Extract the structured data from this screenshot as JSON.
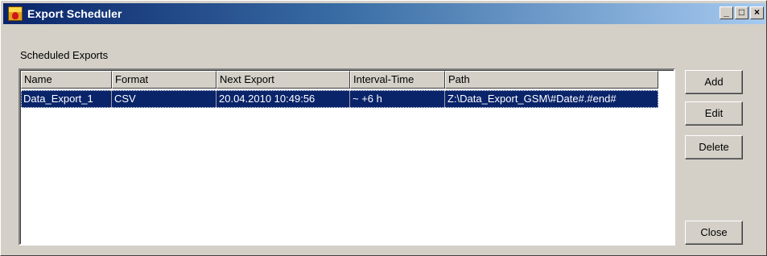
{
  "window": {
    "title": "Export Scheduler",
    "controls": {
      "minimize": "_",
      "maximize": "□",
      "close": "×"
    }
  },
  "group": {
    "label": "Scheduled Exports"
  },
  "table": {
    "columns": [
      "Name",
      "Format",
      "Next Export",
      "Interval-Time",
      "Path"
    ],
    "rows": [
      [
        "Data_Export_1",
        "CSV",
        "20.04.2010 10:49:56",
        "~ +6 h",
        "Z:\\Data_Export_GSM\\#Date#.#end#"
      ]
    ]
  },
  "buttons": {
    "add": "Add",
    "edit": "Edit",
    "delete": "Delete",
    "close": "Close"
  },
  "icons": {
    "app": "export-scheduler-icon"
  }
}
